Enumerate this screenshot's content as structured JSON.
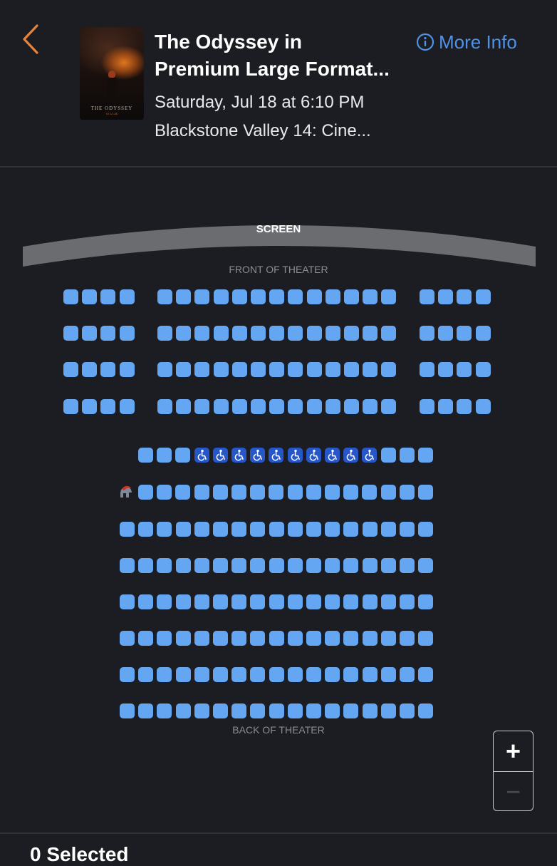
{
  "header": {
    "back_icon": "chevron-left-icon",
    "title_line1": "The Odyssey in",
    "title_line2": "Premium Large Format...",
    "showtime": "Saturday, Jul 18 at 6:10 PM",
    "theater": "Blackstone Valley 14: Cine...",
    "more_info_label": "More Info",
    "more_info_icon": "info-circle-icon",
    "poster": {
      "title_text": "THE ODYSSEY",
      "date_text": "07.17.26"
    }
  },
  "seat_map": {
    "screen_label": "SCREEN",
    "front_label": "FRONT OF THEATER",
    "back_label": "BACK OF THEATER",
    "legend_icon": "spartan-helmet-icon",
    "colors": {
      "available": "#64a6f2",
      "wheelchair": "#2756c9",
      "background": "#1b1d22"
    },
    "upper_section": {
      "rows": 4,
      "blocks": [
        4,
        13,
        4
      ]
    },
    "wheelchair_row": [
      "seat",
      "seat",
      "seat",
      "wheelchair",
      "wheelchair",
      "wheelchair",
      "wheelchair",
      "wheelchair",
      "wheelchair",
      "wheelchair",
      "wheelchair",
      "wheelchair",
      "wheelchair",
      "seat",
      "seat",
      "seat"
    ],
    "lower_section": {
      "rows_with_16": 1,
      "rows_with_17": 6
    }
  },
  "zoom": {
    "in_label": "+",
    "out_label": "−",
    "zoom_out_enabled": false
  },
  "footer": {
    "selected_label": "0 Selected"
  }
}
